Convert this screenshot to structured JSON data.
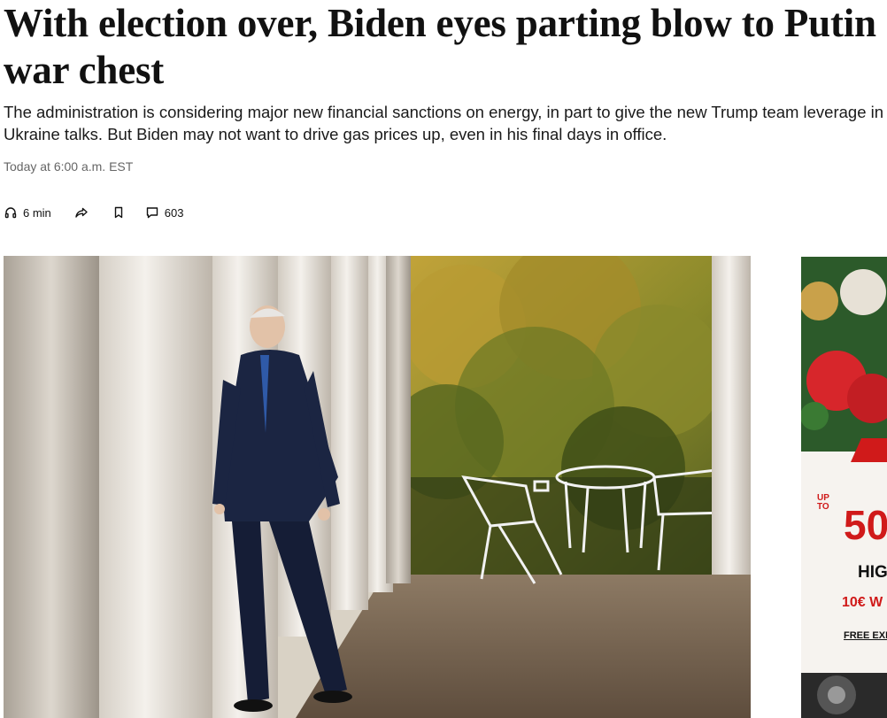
{
  "article": {
    "headline": "With election over, Biden eyes parting blow to Putin war chest",
    "dek": "The administration is considering major new financial sanctions on energy, in part to give the new Trump team leverage in Ukraine talks. But Biden may not want to drive gas prices up, even in his final days in office.",
    "timestamp": "Today at 6:00 a.m. EST"
  },
  "actions": {
    "listen_label": "6 min",
    "listen_icon": "headphones-icon",
    "share_icon": "share-icon",
    "save_icon": "bookmark-icon",
    "comments_icon": "comment-icon",
    "comments_count": "603"
  },
  "ad": {
    "upto": "UP TO",
    "big": "50",
    "line1": "HIG",
    "line2": "10€ W",
    "line3": "FREE EXP",
    "accent": "#d01a1a"
  }
}
